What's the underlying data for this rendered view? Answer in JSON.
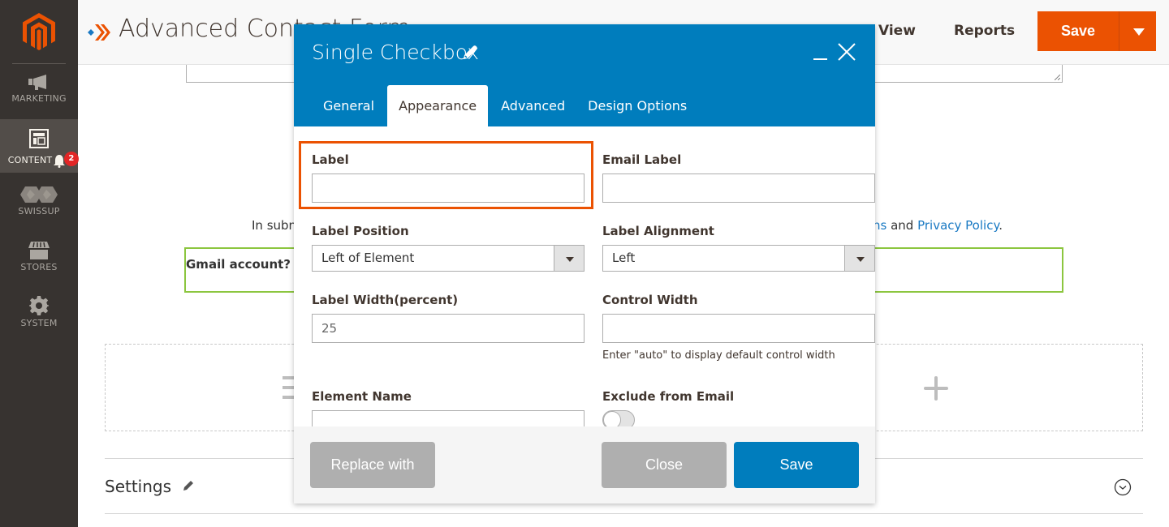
{
  "sidebar": {
    "items": [
      {
        "label": "MARKETING",
        "icon": "megaphone-icon",
        "active": false
      },
      {
        "label": "CONTENT",
        "icon": "layout-icon",
        "active": true,
        "notifications": "2"
      },
      {
        "label": "SWISSUP",
        "icon": "swissup-icon",
        "active": false
      },
      {
        "label": "STORES",
        "icon": "store-icon",
        "active": false
      },
      {
        "label": "SYSTEM",
        "icon": "gear-icon",
        "active": false
      }
    ]
  },
  "header": {
    "title": "Advanced Contact Form",
    "links": [
      "View",
      "Reports"
    ],
    "save_label": "Save"
  },
  "background": {
    "consent_prefix": "In submitting this form you agree to our Terms and Conditions",
    "consent_visible_left": "In subn",
    "consent_visible_right_link1": "ns",
    "consent_and": " and ",
    "consent_link2": "Privacy Policy",
    "consent_end": ".",
    "question_label": "Gmail account?",
    "settings_title": "Settings"
  },
  "modal": {
    "title": "Single Checkbox",
    "tabs": [
      {
        "label": "General",
        "active": false
      },
      {
        "label": "Appearance",
        "active": true
      },
      {
        "label": "Advanced",
        "active": false
      },
      {
        "label": "Design Options",
        "active": false
      }
    ],
    "fields": {
      "label": {
        "label": "Label",
        "value": ""
      },
      "email_label": {
        "label": "Email Label",
        "value": ""
      },
      "label_position": {
        "label": "Label Position",
        "value": "Left of Element"
      },
      "label_alignment": {
        "label": "Label Alignment",
        "value": "Left"
      },
      "label_width": {
        "label": "Label Width(percent)",
        "value": "25"
      },
      "control_width": {
        "label": "Control Width",
        "value": "",
        "hint": "Enter \"auto\" to display default control width"
      },
      "element_name": {
        "label": "Element Name",
        "value": ""
      },
      "exclude_from_email": {
        "label": "Exclude from Email",
        "checked": false
      }
    },
    "footer": {
      "replace_label": "Replace with",
      "close_label": "Close",
      "save_label": "Save"
    }
  },
  "colors": {
    "brand_orange": "#eb5202",
    "modal_blue": "#007dbd",
    "sidebar_bg": "#373330",
    "accent_green": "#8cc63f",
    "link_blue": "#1979c3"
  }
}
